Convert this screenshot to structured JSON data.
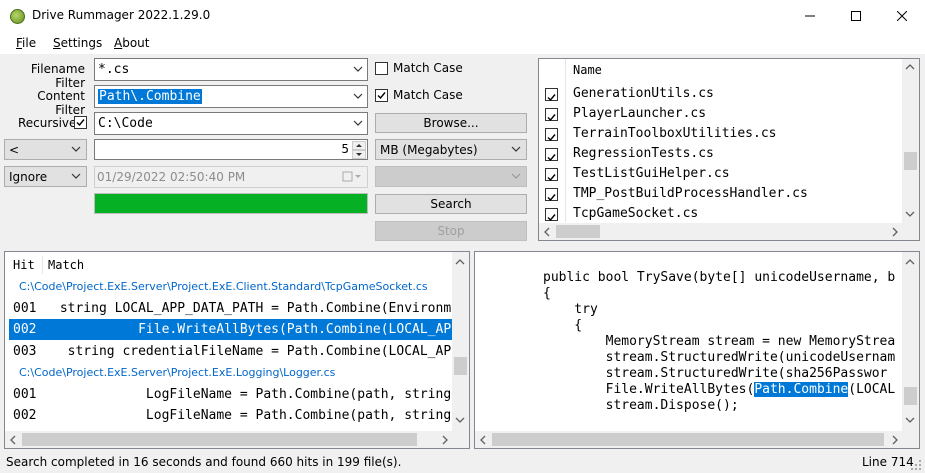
{
  "window": {
    "title": "Drive Rummager 2022.1.29.0",
    "icon": "app-icon"
  },
  "menu": {
    "file": {
      "u": "F",
      "rest": "ile"
    },
    "settings": {
      "u": "S",
      "rest": "ettings"
    },
    "about": {
      "u": "A",
      "rest": "bout"
    }
  },
  "filters": {
    "filename_label": "Filename Filter",
    "filename_value": "*.cs",
    "content_label": "Content Filter",
    "content_value": "Path\\.Combine",
    "recursive_label": "Recursive",
    "recursive_checked": true,
    "path_value": "C:\\Code",
    "match_case_1_label": "Match Case",
    "match_case_1_checked": false,
    "match_case_2_label": "Match Case",
    "match_case_2_checked": true,
    "browse_label": "Browse...",
    "size_operator": "<",
    "size_value": "5",
    "size_unit": "MB (Megabytes)",
    "date_operator": "Ignore",
    "date_value": "01/29/2022 02:50:40 PM",
    "date_extra": ""
  },
  "progress": {
    "value": 1.0,
    "color": "#06b025"
  },
  "buttons": {
    "search": "Search",
    "stop": "Stop"
  },
  "files": {
    "header": "Name",
    "items": [
      {
        "name": "GenerationUtils.cs",
        "checked": true
      },
      {
        "name": "PlayerLauncher.cs",
        "checked": true
      },
      {
        "name": "TerrainToolboxUtilities.cs",
        "checked": true
      },
      {
        "name": "RegressionTests.cs",
        "checked": true
      },
      {
        "name": "TestListGuiHelper.cs",
        "checked": true
      },
      {
        "name": "TMP_PostBuildProcessHandler.cs",
        "checked": true
      },
      {
        "name": "TcpGameSocket.cs",
        "checked": true
      }
    ]
  },
  "hits": {
    "col_hit": "Hit",
    "col_match": "Match",
    "rows": [
      {
        "kind": "file",
        "text": "C:\\Code\\Project.ExE.Server\\Project.ExE.Client.Standard\\TcpGameSocket.cs"
      },
      {
        "kind": "hit",
        "hit": "001",
        "text": " string LOCAL_APP_DATA_PATH = Path.Combine(Environm"
      },
      {
        "kind": "hit",
        "hit": "002",
        "text": "           File.WriteAllBytes(Path.Combine(LOCAL_AP",
        "selected": true
      },
      {
        "kind": "hit",
        "hit": "003",
        "text": "  string credentialFileName = Path.Combine(LOCAL_AP"
      },
      {
        "kind": "file",
        "text": "C:\\Code\\Project.ExE.Server\\Project.ExE.Logging\\Logger.cs"
      },
      {
        "kind": "hit",
        "hit": "001",
        "text": "            LogFileName = Path.Combine(path, string"
      },
      {
        "kind": "hit",
        "hit": "002",
        "text": "            LogFileName = Path.Combine(path, string"
      }
    ]
  },
  "preview": {
    "lines": [
      {
        "pre": "public bool TrySave(byte[] unicodeUsername, b",
        "match": "",
        "post": ""
      },
      {
        "pre": "{",
        "match": "",
        "post": ""
      },
      {
        "pre": "    try",
        "match": "",
        "post": ""
      },
      {
        "pre": "    {",
        "match": "",
        "post": ""
      },
      {
        "pre": "        MemoryStream stream = new MemoryStrea",
        "match": "",
        "post": ""
      },
      {
        "pre": "        stream.StructuredWrite(unicodeUsernam",
        "match": "",
        "post": ""
      },
      {
        "pre": "        stream.StructuredWrite(sha256Passwor",
        "match": "",
        "post": ""
      },
      {
        "pre": "        File.WriteAllBytes(",
        "match": "Path.Combine",
        "post": "(LOCAL"
      },
      {
        "pre": "        stream.Dispose();",
        "match": "",
        "post": ""
      }
    ]
  },
  "status": {
    "message": "Search completed in 16 seconds and found 660 hits in 199 file(s).",
    "line": "Line 714"
  }
}
